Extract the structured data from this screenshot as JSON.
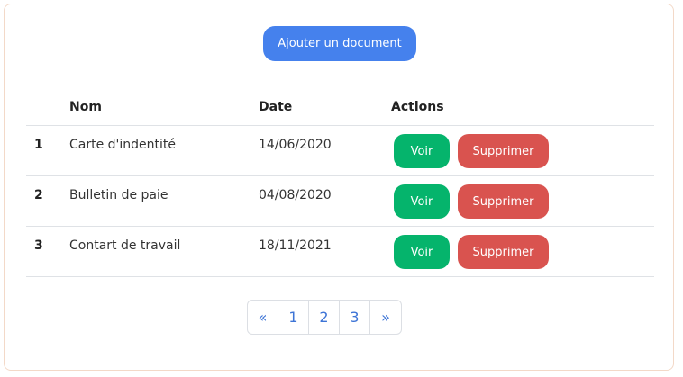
{
  "toolbar": {
    "add_label": "Ajouter un document"
  },
  "table": {
    "headers": {
      "index": "",
      "name": "Nom",
      "date": "Date",
      "actions": "Actions"
    },
    "rows": [
      {
        "index": "1",
        "name": "Carte d'indentité",
        "date": "14/06/2020",
        "view_label": "Voir",
        "delete_label": "Supprimer"
      },
      {
        "index": "2",
        "name": "Bulletin de paie",
        "date": "04/08/2020",
        "view_label": "Voir",
        "delete_label": "Supprimer"
      },
      {
        "index": "3",
        "name": "Contart de travail",
        "date": "18/11/2021",
        "view_label": "Voir",
        "delete_label": "Supprimer"
      }
    ]
  },
  "pagination": {
    "prev": "«",
    "pages": [
      "1",
      "2",
      "3"
    ],
    "next": "»"
  },
  "colors": {
    "primary": "#4581ed",
    "success": "#05b46c",
    "danger": "#d9534f",
    "link": "#3d74d6"
  }
}
